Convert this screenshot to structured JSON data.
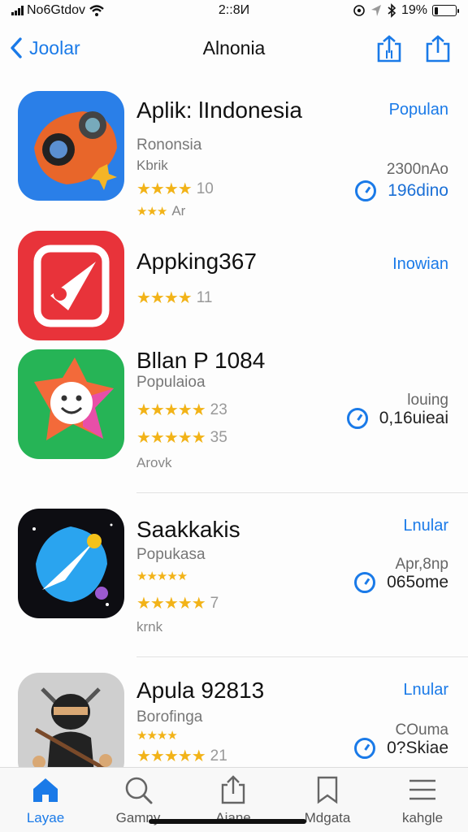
{
  "status_bar": {
    "carrier": "No6Gtdov",
    "time": "2::8И",
    "battery": "19%",
    "battery_level": 0.19
  },
  "nav": {
    "back_label": "Joolar",
    "title": "Alnonia"
  },
  "apps": [
    {
      "name": "Aplik: lIndonesia",
      "line1": "Rononsia",
      "line2": "Kbrik",
      "rating_text": "10",
      "reviews": "Ar",
      "rank_label": "Populan",
      "meta_top": "2300nAo",
      "meta_bottom": "196dino"
    },
    {
      "name": "Appking367",
      "rating_text": "11",
      "rank_label": "Inowian"
    },
    {
      "name": "Bllan P 1084",
      "line1": "Populaioa",
      "rating1": "23",
      "rating2": "35",
      "reviews": "Arovk",
      "meta_top": "louing",
      "meta_bottom": "0,16uieai"
    },
    {
      "name": "Saakkakis",
      "line1": "Popukasa",
      "rating2": "7",
      "reviews": "krnk",
      "rank_label": "Lnular",
      "meta_top": "Apr,8np",
      "meta_bottom": "065ome"
    },
    {
      "name": "Apula 92813",
      "line1": "Borofinga",
      "rating2": "21",
      "rank_label": "Lnular",
      "meta_top": "COuma",
      "meta_bottom": "0?Skiae"
    }
  ],
  "tabs": [
    {
      "label": "Layae",
      "icon": "home-icon",
      "active": true
    },
    {
      "label": "Gamny",
      "icon": "search-icon"
    },
    {
      "label": "Aiane",
      "icon": "share-icon"
    },
    {
      "label": "Mdgata",
      "icon": "bookmark-icon"
    },
    {
      "label": "kahgle",
      "icon": "menu-icon"
    }
  ],
  "colors": {
    "accent": "#1a7ae8",
    "star": "#f2b318"
  }
}
